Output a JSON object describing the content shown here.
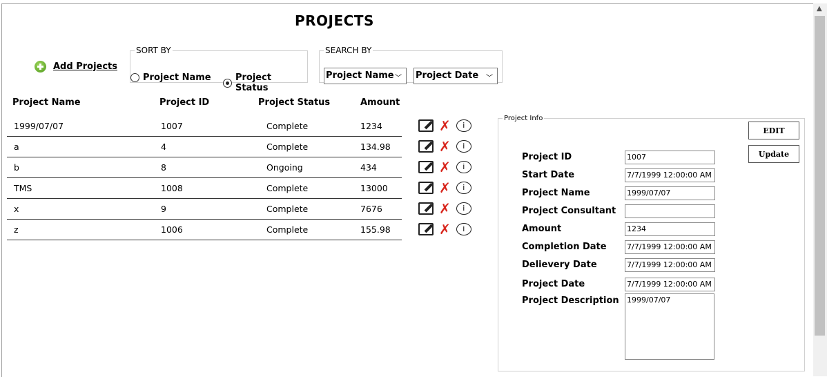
{
  "page": {
    "title": "PROJECTS"
  },
  "add": {
    "label": "Add Projects"
  },
  "sort": {
    "legend": "SORT BY",
    "options": [
      {
        "label": "Project Name",
        "selected": false
      },
      {
        "label": "Project Status",
        "selected": true
      }
    ]
  },
  "search": {
    "legend": "SEARCH BY",
    "field1": "Project Name",
    "field2": "Project Date"
  },
  "table": {
    "headers": [
      "Project Name",
      "Project ID",
      "Project Status",
      "Amount"
    ],
    "rows": [
      [
        "1999/07/07",
        "1007",
        "Complete",
        "1234"
      ],
      [
        "a",
        "4",
        "Complete",
        "134.98"
      ],
      [
        "b",
        "8",
        "Ongoing",
        "434"
      ],
      [
        "TMS",
        "1008",
        "Complete",
        "13000"
      ],
      [
        "x",
        "9",
        "Complete",
        "7676"
      ],
      [
        "z",
        "1006",
        "Complete",
        "155.98"
      ]
    ]
  },
  "info": {
    "legend": "Project Info",
    "edit": "EDIT",
    "update": "Update",
    "fields": [
      {
        "label": "Project ID",
        "value": "1007"
      },
      {
        "label": "Start Date",
        "value": "7/7/1999 12:00:00 AM"
      },
      {
        "label": "Project Name",
        "value": "1999/07/07"
      },
      {
        "label": "Project Consultant",
        "value": ""
      },
      {
        "label": "Amount",
        "value": "1234"
      },
      {
        "label": "Completion Date",
        "value": "7/7/1999 12:00:00 AM"
      },
      {
        "label": "Delievery Date",
        "value": "7/7/1999 12:00:00 AM"
      },
      {
        "label": "Project Date",
        "value": "7/7/1999 12:00:00 AM"
      }
    ],
    "description_label": "Project Description",
    "description": "1999/07/07"
  }
}
